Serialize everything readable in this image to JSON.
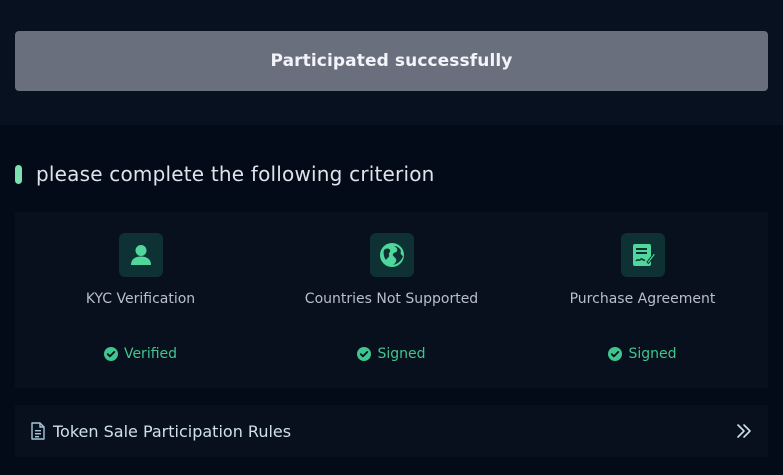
{
  "banner": {
    "label": "Participated successfully"
  },
  "criteria_section": {
    "heading": "please complete the following criterion",
    "items": [
      {
        "label": "KYC Verification",
        "status": "Verified",
        "icon": "user-icon"
      },
      {
        "label": "Countries Not Supported",
        "status": "Signed",
        "icon": "globe-icon"
      },
      {
        "label": "Purchase Agreement",
        "status": "Signed",
        "icon": "signed-document-icon"
      }
    ]
  },
  "rules": {
    "label": "Token Sale Participation Rules",
    "icon": "document-icon",
    "arrow_icon": "double-chevron-right-icon"
  },
  "colors": {
    "accent": "#3fc68f",
    "banner_bg": "#6a6f7e",
    "page_bg": "#040b18",
    "panel_bg": "#07101c",
    "icon_box_bg": "#0e3134"
  }
}
